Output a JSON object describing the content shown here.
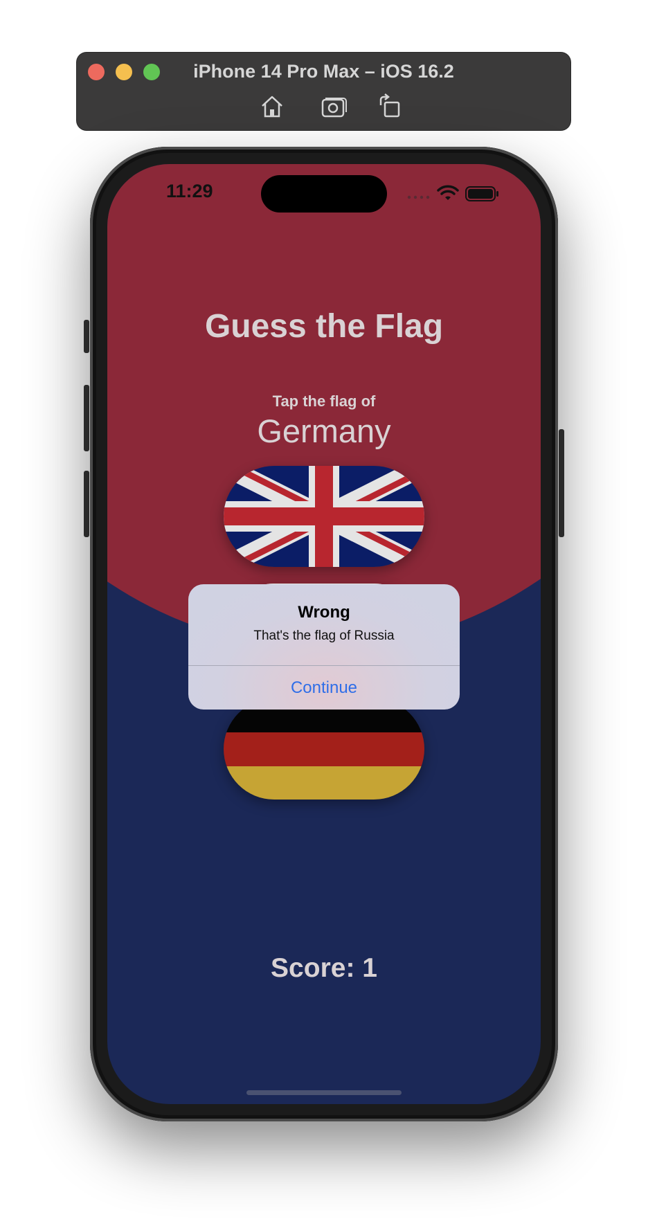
{
  "simulator": {
    "title": "iPhone 14 Pro Max – iOS 16.2",
    "tools": [
      "home-icon",
      "screenshot-icon",
      "rotate-icon"
    ]
  },
  "status_bar": {
    "time": "11:29"
  },
  "game": {
    "title": "Guess the Flag",
    "prompt": "Tap the flag of",
    "country": "Germany",
    "flags": [
      "UK",
      "Russia",
      "Germany"
    ],
    "score_label": "Score: 1"
  },
  "alert": {
    "title": "Wrong",
    "message": "That's the flag of Russia",
    "button": "Continue"
  },
  "colors": {
    "top_background": "#8b2838",
    "bottom_background": "#1b2857",
    "accent_blue": "#2f6ee8"
  }
}
